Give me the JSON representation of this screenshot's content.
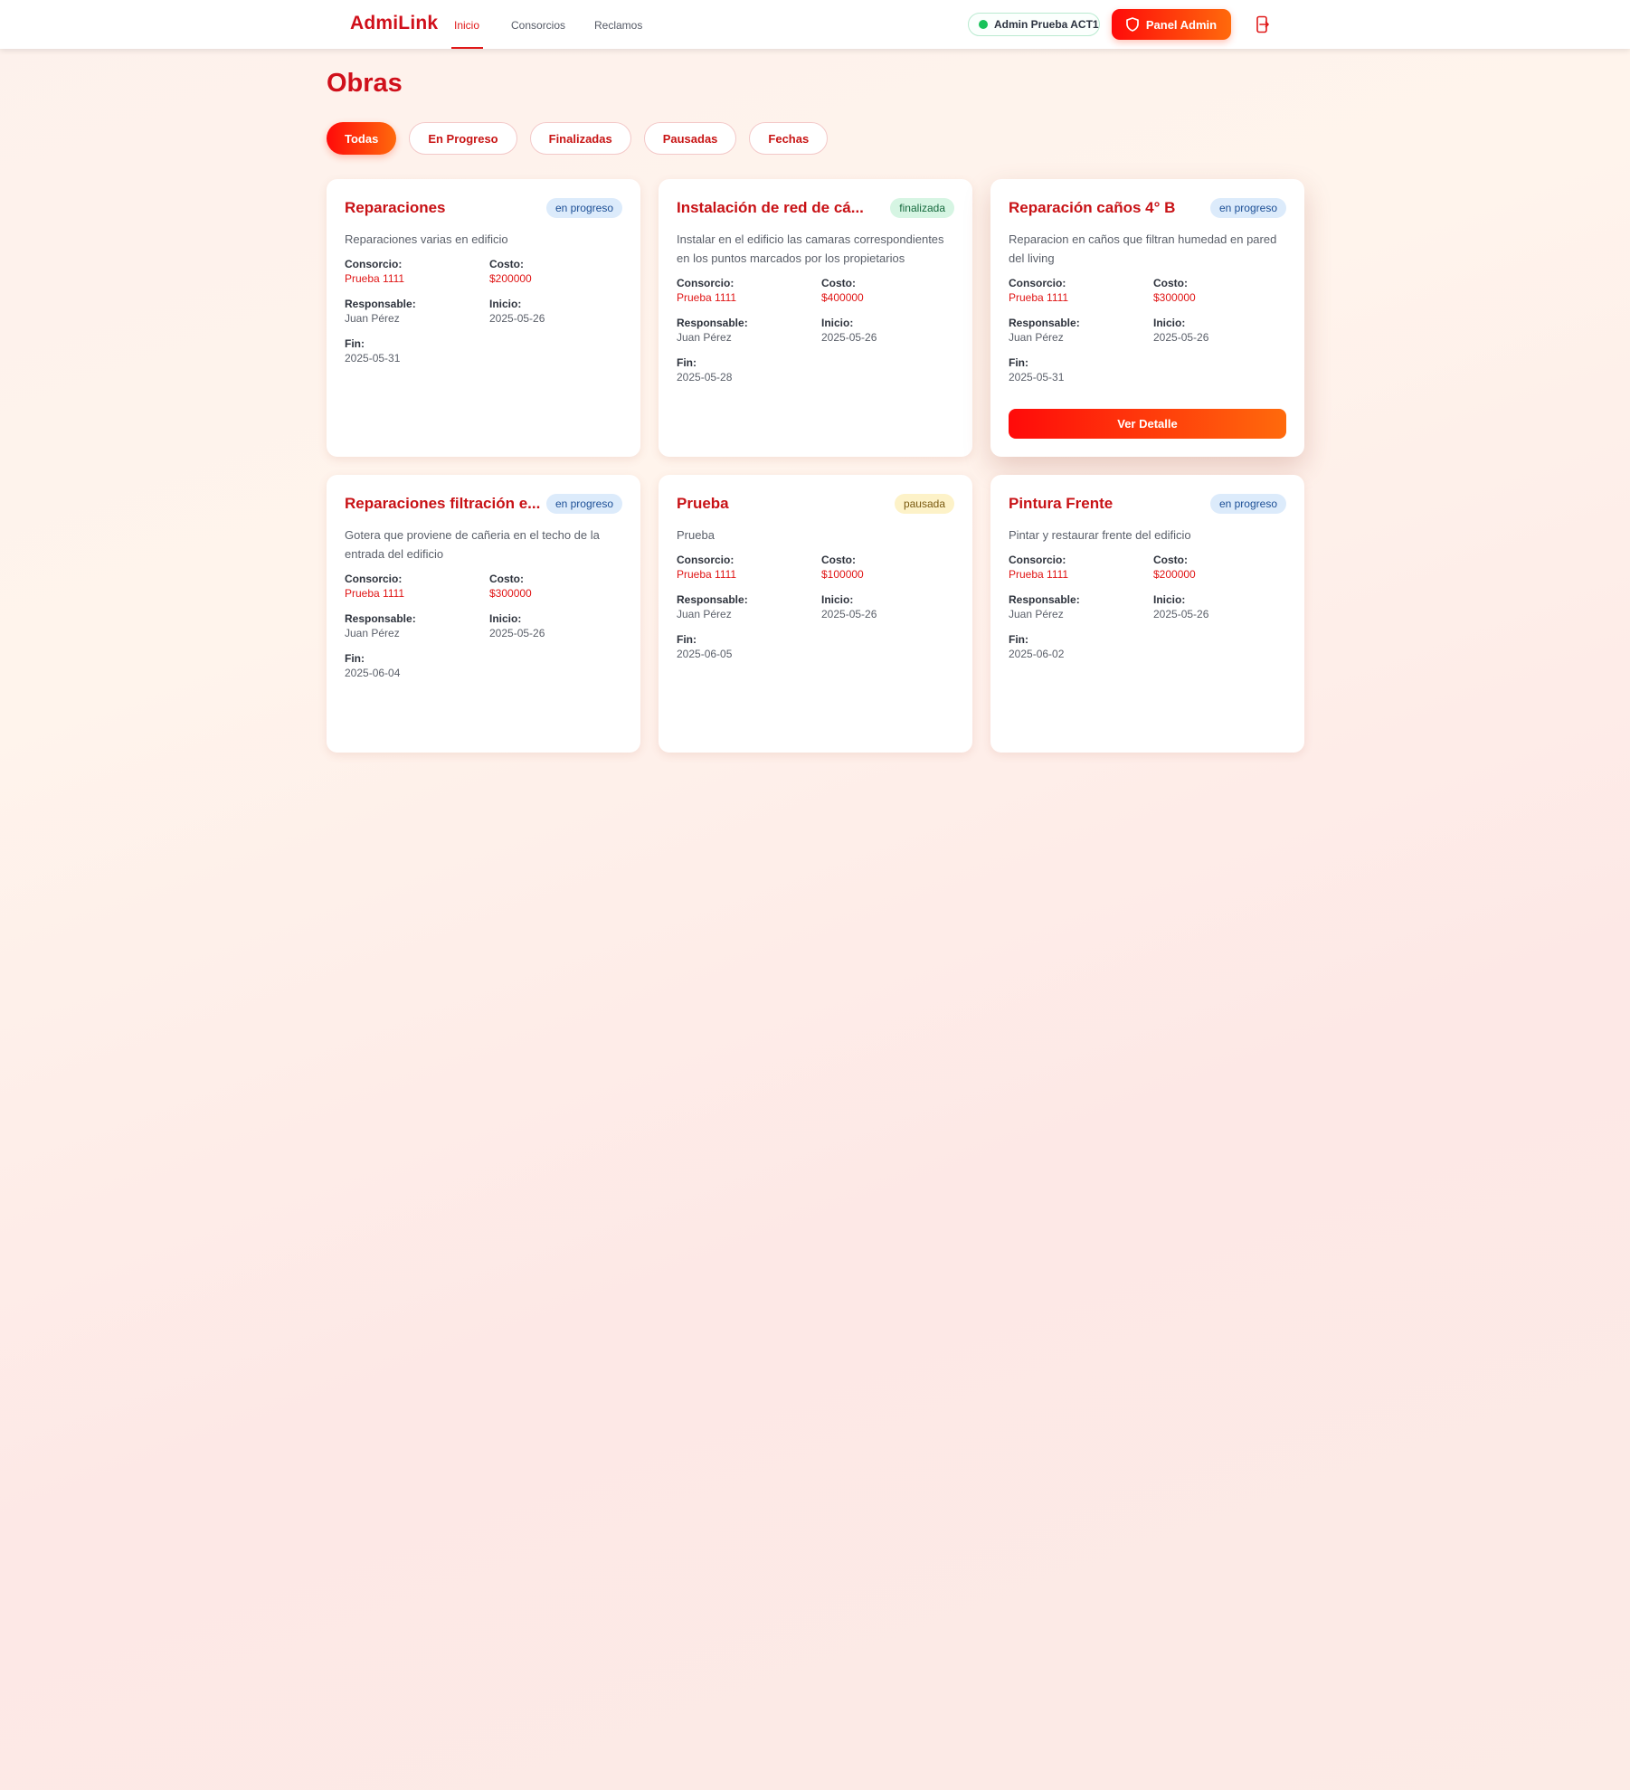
{
  "header": {
    "brand": "AdmiLink",
    "nav": [
      {
        "label": "Inicio",
        "active": true
      },
      {
        "label": "Consorcios",
        "active": false
      },
      {
        "label": "Reclamos",
        "active": false
      }
    ],
    "user_label": "Admin Prueba ACT1",
    "user_status_color": "#19c25a",
    "admin_button_label": "Panel Admin",
    "admin_button_icon": "shield-icon",
    "logout_icon": "logout-icon"
  },
  "page": {
    "title": "Obras",
    "filters": [
      {
        "label": "Todas",
        "active": true
      },
      {
        "label": "En Progreso",
        "active": false
      },
      {
        "label": "Finalizadas",
        "active": false
      },
      {
        "label": "Pausadas",
        "active": false
      },
      {
        "label": "Fechas",
        "active": false
      }
    ]
  },
  "labels": {
    "consorcio": "Consorcio:",
    "costo": "Costo:",
    "responsable": "Responsable:",
    "inicio": "Inicio:",
    "fin": "Fin:",
    "ver_detalle": "Ver Detalle"
  },
  "obras": [
    {
      "title": "Reparaciones",
      "status": "en progreso",
      "description": "Reparaciones varias en edificio",
      "consorcio": "Prueba 1111",
      "costo": "$200000",
      "responsable": "Juan Pérez",
      "inicio": "2025-05-26",
      "fin": "2025-05-31"
    },
    {
      "title": "Instalación de red de cá...",
      "status": "finalizada",
      "description": "Instalar en el edificio las camaras correspondientes en los puntos marcados por los propietarios",
      "consorcio": "Prueba 1111",
      "costo": "$400000",
      "responsable": "Juan Pérez",
      "inicio": "2025-05-26",
      "fin": "2025-05-28"
    },
    {
      "title": "Reparación caños 4° B",
      "status": "en progreso",
      "description": "Reparacion en caños que filtran humedad en pared del living",
      "consorcio": "Prueba 1111",
      "costo": "$300000",
      "responsable": "Juan Pérez",
      "inicio": "2025-05-26",
      "fin": "2025-05-31",
      "show_detail_button": true
    },
    {
      "title": "Reparaciones filtración e...",
      "status": "en progreso",
      "description": "Gotera que proviene de cañeria en el techo de la entrada del edificio",
      "consorcio": "Prueba 1111",
      "costo": "$300000",
      "responsable": "Juan Pérez",
      "inicio": "2025-05-26",
      "fin": "2025-06-04"
    },
    {
      "title": "Prueba",
      "status": "pausada",
      "description": "Prueba",
      "consorcio": "Prueba 1111",
      "costo": "$100000",
      "responsable": "Juan Pérez",
      "inicio": "2025-05-26",
      "fin": "2025-06-05"
    },
    {
      "title": "Pintura Frente",
      "status": "en progreso",
      "description": "Pintar y restaurar frente del edificio",
      "consorcio": "Prueba 1111",
      "costo": "$200000",
      "responsable": "Juan Pérez",
      "inicio": "2025-05-26",
      "fin": "2025-06-02"
    }
  ]
}
